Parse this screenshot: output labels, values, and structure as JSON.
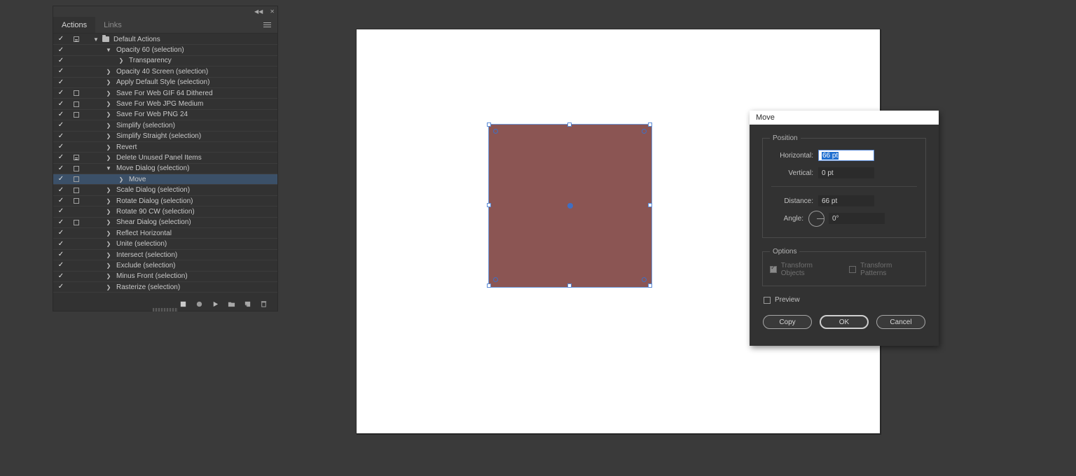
{
  "panel": {
    "topbar": {
      "collapse_icon": "collapse-icon",
      "close_icon": "close-icon"
    },
    "tabs": [
      {
        "label": "Actions",
        "active": true
      },
      {
        "label": "Links",
        "active": false
      }
    ],
    "menu_icon": "hamburger-menu-icon",
    "rows": [
      {
        "label": "Default Actions",
        "checked": true,
        "dialog": "filled",
        "twisty": "v",
        "indent": 0,
        "folder": true,
        "selected": false
      },
      {
        "label": "Opacity 60 (selection)",
        "checked": true,
        "dialog": "none",
        "twisty": "v",
        "indent": 1,
        "folder": false,
        "selected": false
      },
      {
        "label": "Transparency",
        "checked": true,
        "dialog": "none",
        "twisty": ">",
        "indent": 2,
        "folder": false,
        "selected": false
      },
      {
        "label": "Opacity 40 Screen (selection)",
        "checked": true,
        "dialog": "none",
        "twisty": ">",
        "indent": 1,
        "folder": false,
        "selected": false
      },
      {
        "label": "Apply Default Style (selection)",
        "checked": true,
        "dialog": "none",
        "twisty": ">",
        "indent": 1,
        "folder": false,
        "selected": false
      },
      {
        "label": "Save For Web GIF 64 Dithered",
        "checked": true,
        "dialog": "empty",
        "twisty": ">",
        "indent": 1,
        "folder": false,
        "selected": false
      },
      {
        "label": "Save For Web JPG Medium",
        "checked": true,
        "dialog": "empty",
        "twisty": ">",
        "indent": 1,
        "folder": false,
        "selected": false
      },
      {
        "label": "Save For Web PNG 24",
        "checked": true,
        "dialog": "empty",
        "twisty": ">",
        "indent": 1,
        "folder": false,
        "selected": false
      },
      {
        "label": "Simplify (selection)",
        "checked": true,
        "dialog": "none",
        "twisty": ">",
        "indent": 1,
        "folder": false,
        "selected": false
      },
      {
        "label": "Simplify Straight (selection)",
        "checked": true,
        "dialog": "none",
        "twisty": ">",
        "indent": 1,
        "folder": false,
        "selected": false
      },
      {
        "label": "Revert",
        "checked": true,
        "dialog": "none",
        "twisty": ">",
        "indent": 1,
        "folder": false,
        "selected": false
      },
      {
        "label": "Delete Unused Panel Items",
        "checked": true,
        "dialog": "filled",
        "twisty": ">",
        "indent": 1,
        "folder": false,
        "selected": false
      },
      {
        "label": "Move Dialog (selection)",
        "checked": true,
        "dialog": "empty",
        "twisty": "v",
        "indent": 1,
        "folder": false,
        "selected": false
      },
      {
        "label": "Move",
        "checked": true,
        "dialog": "empty",
        "twisty": ">",
        "indent": 2,
        "folder": false,
        "selected": true
      },
      {
        "label": "Scale Dialog (selection)",
        "checked": true,
        "dialog": "empty",
        "twisty": ">",
        "indent": 1,
        "folder": false,
        "selected": false
      },
      {
        "label": "Rotate Dialog (selection)",
        "checked": true,
        "dialog": "empty",
        "twisty": ">",
        "indent": 1,
        "folder": false,
        "selected": false
      },
      {
        "label": "Rotate 90 CW (selection)",
        "checked": true,
        "dialog": "none",
        "twisty": ">",
        "indent": 1,
        "folder": false,
        "selected": false
      },
      {
        "label": "Shear Dialog (selection)",
        "checked": true,
        "dialog": "empty",
        "twisty": ">",
        "indent": 1,
        "folder": false,
        "selected": false
      },
      {
        "label": "Reflect Horizontal",
        "checked": true,
        "dialog": "none",
        "twisty": ">",
        "indent": 1,
        "folder": false,
        "selected": false
      },
      {
        "label": "Unite (selection)",
        "checked": true,
        "dialog": "none",
        "twisty": ">",
        "indent": 1,
        "folder": false,
        "selected": false
      },
      {
        "label": "Intersect (selection)",
        "checked": true,
        "dialog": "none",
        "twisty": ">",
        "indent": 1,
        "folder": false,
        "selected": false
      },
      {
        "label": "Exclude (selection)",
        "checked": true,
        "dialog": "none",
        "twisty": ">",
        "indent": 1,
        "folder": false,
        "selected": false
      },
      {
        "label": "Minus Front (selection)",
        "checked": true,
        "dialog": "none",
        "twisty": ">",
        "indent": 1,
        "folder": false,
        "selected": false
      },
      {
        "label": "Rasterize (selection)",
        "checked": true,
        "dialog": "none",
        "twisty": ">",
        "indent": 1,
        "folder": false,
        "selected": false
      }
    ],
    "footer_icons": [
      "stop-icon",
      "record-icon",
      "play-icon",
      "new-set-icon",
      "new-action-icon",
      "delete-icon"
    ]
  },
  "dialog": {
    "title": "Move",
    "position_group": "Position",
    "horizontal": {
      "label": "Horizontal:",
      "value": "66 pt",
      "focused": true
    },
    "vertical": {
      "label": "Vertical:",
      "value": "0 pt"
    },
    "distance": {
      "label": "Distance:",
      "value": "66 pt"
    },
    "angle": {
      "label": "Angle:",
      "value": "0°",
      "dial_icon": "angle-dial-icon"
    },
    "options_group": "Options",
    "transform_objects": {
      "label": "Transform Objects",
      "checked": true,
      "disabled": true
    },
    "transform_patterns": {
      "label": "Transform Patterns",
      "checked": false,
      "disabled": true
    },
    "preview": {
      "label": "Preview",
      "checked": false
    },
    "buttons": {
      "copy": "Copy",
      "ok": "OK",
      "cancel": "Cancel"
    }
  },
  "canvas": {
    "shape_fill": "#8b5553",
    "selection_color": "#5a8ad6",
    "artboard_color": "#ffffff"
  },
  "colors": {
    "app_background": "#3a3a3a",
    "panel_background": "#323232",
    "selected_row": "#3b5068",
    "focus_blue": "#1f6fd0"
  }
}
